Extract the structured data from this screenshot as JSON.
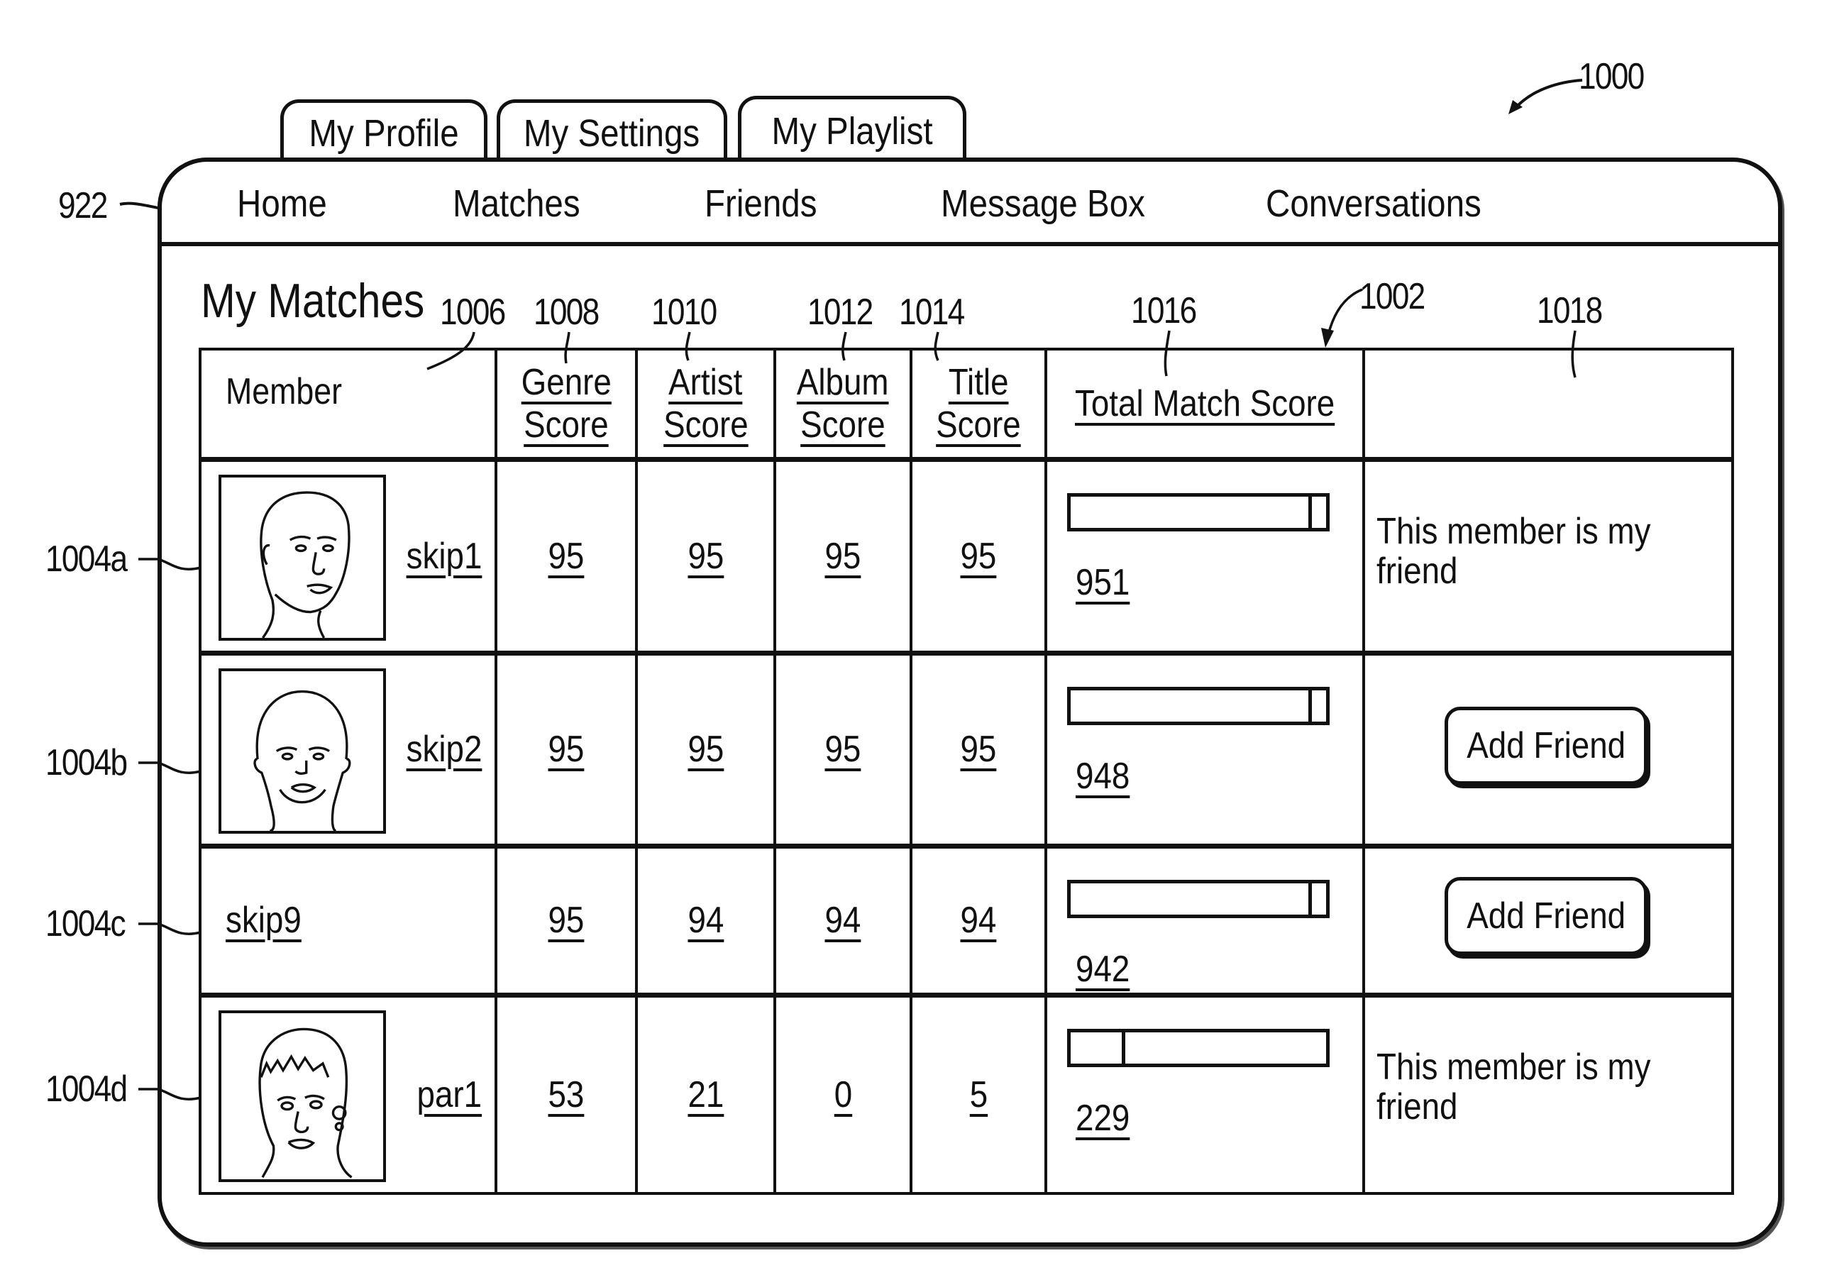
{
  "figure": {
    "ref_window": "1000",
    "ref_nav": "922",
    "ref_table": "1002",
    "ref_member_col": "1006",
    "ref_genre_col": "1008",
    "ref_artist_col": "1010",
    "ref_album_col": "1012",
    "ref_title_col": "1014",
    "ref_total_col": "1016",
    "ref_status_col": "1018",
    "ref_rows": [
      "1004a",
      "1004b",
      "1004c",
      "1004d"
    ]
  },
  "tabs": [
    {
      "label": "My Profile"
    },
    {
      "label": "My Settings"
    },
    {
      "label": "My Playlist"
    }
  ],
  "nav": [
    {
      "label": "Home"
    },
    {
      "label": "Matches"
    },
    {
      "label": "Friends"
    },
    {
      "label": "Message Box"
    },
    {
      "label": "Conversations"
    }
  ],
  "page_title": "My Matches",
  "table": {
    "headers": {
      "member": "Member",
      "genre": [
        "Genre",
        "Score"
      ],
      "artist": [
        "Artist",
        "Score"
      ],
      "album": [
        "Album",
        "Score"
      ],
      "title": [
        "Title",
        "Score"
      ],
      "total": "Total Match Score",
      "status": ""
    },
    "rows": [
      {
        "member": "skip1",
        "has_avatar": true,
        "avatar_icon": "face-portrait-icon",
        "genre": "95",
        "artist": "95",
        "album": "95",
        "title": "95",
        "total": "951",
        "bar_fraction": 0.93,
        "status": "friend",
        "status_text": "This member is my friend"
      },
      {
        "member": "skip2",
        "has_avatar": true,
        "avatar_icon": "face-portrait-icon",
        "genre": "95",
        "artist": "95",
        "album": "95",
        "title": "95",
        "total": "948",
        "bar_fraction": 0.93,
        "status": "add",
        "button_label": "Add Friend"
      },
      {
        "member": "skip9",
        "has_avatar": false,
        "genre": "95",
        "artist": "94",
        "album": "94",
        "title": "94",
        "total": "942",
        "bar_fraction": 0.93,
        "status": "add",
        "button_label": "Add Friend"
      },
      {
        "member": "par1",
        "has_avatar": true,
        "avatar_icon": "face-portrait-icon",
        "genre": "53",
        "artist": "21",
        "album": "0",
        "title": "5",
        "total": "229",
        "bar_fraction": 0.2,
        "status": "friend",
        "status_text": "This member is my friend"
      }
    ]
  }
}
